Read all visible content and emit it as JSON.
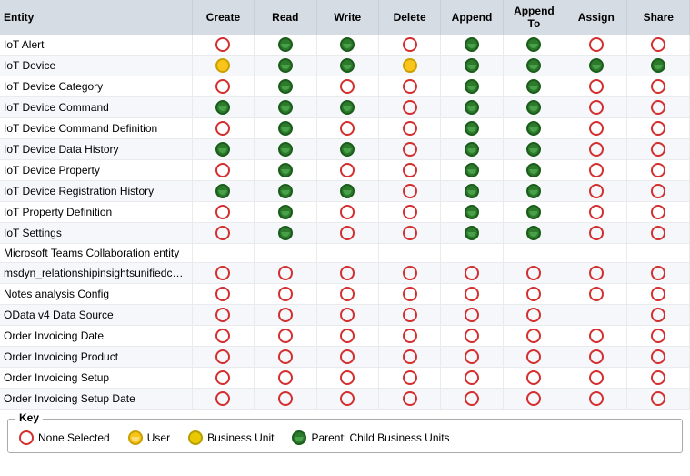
{
  "table": {
    "headers": [
      "Entity",
      "Create",
      "Read",
      "Write",
      "Delete",
      "Append",
      "Append To",
      "Assign",
      "Share"
    ],
    "rows": [
      {
        "entity": "IoT Alert",
        "create": "empty",
        "read": "green",
        "write": "green",
        "delete": "empty",
        "append": "green",
        "appendTo": "green",
        "assign": "empty",
        "share": "empty"
      },
      {
        "entity": "IoT Device",
        "create": "yellow",
        "read": "green",
        "write": "green",
        "delete": "yellow",
        "append": "green",
        "appendTo": "green",
        "assign": "green",
        "share": "green"
      },
      {
        "entity": "IoT Device Category",
        "create": "empty",
        "read": "green",
        "write": "empty",
        "delete": "empty",
        "append": "green",
        "appendTo": "green",
        "assign": "empty",
        "share": "empty"
      },
      {
        "entity": "IoT Device Command",
        "create": "green",
        "read": "green",
        "write": "green",
        "delete": "empty",
        "append": "green",
        "appendTo": "green",
        "assign": "empty",
        "share": "empty"
      },
      {
        "entity": "IoT Device Command Definition",
        "create": "empty",
        "read": "green",
        "write": "empty",
        "delete": "empty",
        "append": "green",
        "appendTo": "green",
        "assign": "empty",
        "share": "empty"
      },
      {
        "entity": "IoT Device Data History",
        "create": "green",
        "read": "green",
        "write": "green",
        "delete": "empty",
        "append": "green",
        "appendTo": "green",
        "assign": "empty",
        "share": "empty"
      },
      {
        "entity": "IoT Device Property",
        "create": "empty",
        "read": "green",
        "write": "empty",
        "delete": "empty",
        "append": "green",
        "appendTo": "green",
        "assign": "empty",
        "share": "empty"
      },
      {
        "entity": "IoT Device Registration History",
        "create": "green",
        "read": "green",
        "write": "green",
        "delete": "empty",
        "append": "green",
        "appendTo": "green",
        "assign": "empty",
        "share": "empty"
      },
      {
        "entity": "IoT Property Definition",
        "create": "empty",
        "read": "green",
        "write": "empty",
        "delete": "empty",
        "append": "green",
        "appendTo": "green",
        "assign": "empty",
        "share": "empty"
      },
      {
        "entity": "IoT Settings",
        "create": "empty",
        "read": "green",
        "write": "empty",
        "delete": "empty",
        "append": "green",
        "appendTo": "green",
        "assign": "empty",
        "share": "empty"
      },
      {
        "entity": "Microsoft Teams Collaboration entity",
        "create": "",
        "read": "",
        "write": "",
        "delete": "",
        "append": "",
        "appendTo": "",
        "assign": "",
        "share": ""
      },
      {
        "entity": "msdyn_relationshipinsightsunifiedconfig",
        "create": "empty",
        "read": "empty",
        "write": "empty",
        "delete": "empty",
        "append": "empty",
        "appendTo": "empty",
        "assign": "empty",
        "share": "empty"
      },
      {
        "entity": "Notes analysis Config",
        "create": "empty",
        "read": "empty",
        "write": "empty",
        "delete": "empty",
        "append": "empty",
        "appendTo": "empty",
        "assign": "empty",
        "share": "empty"
      },
      {
        "entity": "OData v4 Data Source",
        "create": "empty",
        "read": "empty",
        "write": "empty",
        "delete": "empty",
        "append": "empty",
        "appendTo": "empty",
        "assign": "",
        "share": "empty"
      },
      {
        "entity": "Order Invoicing Date",
        "create": "empty",
        "read": "empty",
        "write": "empty",
        "delete": "empty",
        "append": "empty",
        "appendTo": "empty",
        "assign": "empty",
        "share": "empty"
      },
      {
        "entity": "Order Invoicing Product",
        "create": "empty",
        "read": "empty",
        "write": "empty",
        "delete": "empty",
        "append": "empty",
        "appendTo": "empty",
        "assign": "empty",
        "share": "empty"
      },
      {
        "entity": "Order Invoicing Setup",
        "create": "empty",
        "read": "empty",
        "write": "empty",
        "delete": "empty",
        "append": "empty",
        "appendTo": "empty",
        "assign": "empty",
        "share": "empty"
      },
      {
        "entity": "Order Invoicing Setup Date",
        "create": "empty",
        "read": "empty",
        "write": "empty",
        "delete": "empty",
        "append": "empty",
        "appendTo": "empty",
        "assign": "empty",
        "share": "empty"
      }
    ]
  },
  "key": {
    "title": "Key",
    "items": [
      {
        "icon": "empty",
        "label": "None Selected"
      },
      {
        "icon": "yellow",
        "label": "User"
      },
      {
        "icon": "yellow-bu",
        "label": "Business Unit"
      },
      {
        "icon": "green",
        "label": "Parent: Child Business Units"
      }
    ]
  }
}
